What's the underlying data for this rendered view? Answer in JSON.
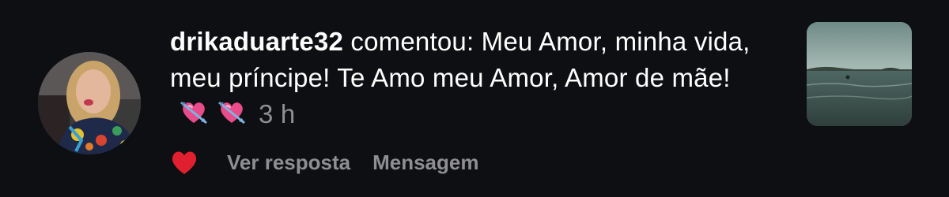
{
  "notification": {
    "username": "drikaduarte32",
    "action_text": " comentou: Meu Amor, minha vida, meu príncipe! Te Amo meu Amor, Amor de mãe!",
    "emojis": [
      "heart-with-arrow-emoji",
      "heart-with-arrow-emoji"
    ],
    "time": "3 h"
  },
  "actions": {
    "like_icon": "heart-icon",
    "like_color": "#e0202e",
    "reply_label": "Ver resposta",
    "message_label": "Mensagem"
  },
  "colors": {
    "background": "#0e0f13",
    "text_primary": "#ffffff",
    "text_secondary": "#8e8e93",
    "emoji_heart": "#e84c8a",
    "emoji_arrow": "#7fb3e0"
  }
}
